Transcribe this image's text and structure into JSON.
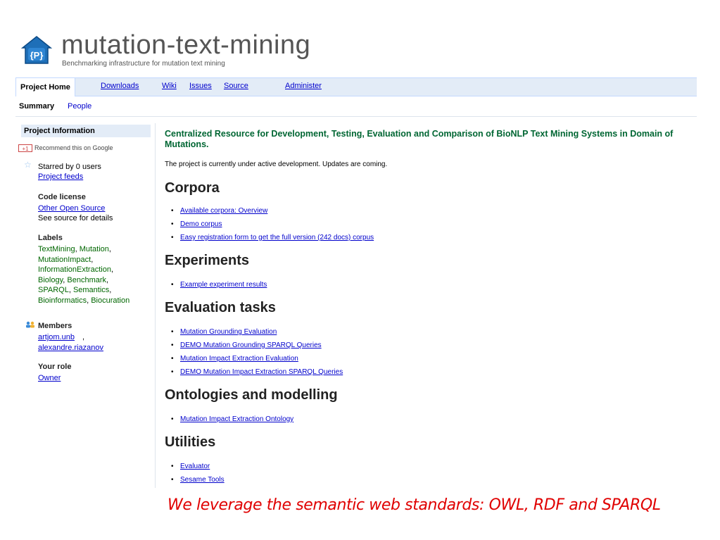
{
  "header": {
    "title": "mutation-text-mining",
    "subtitle": "Benchmarking infrastructure for mutation text mining"
  },
  "tabs": {
    "project_home": "Project Home",
    "downloads": "Downloads",
    "wiki": "Wiki",
    "issues": "Issues",
    "source": "Source",
    "administer": "Administer"
  },
  "subtabs": {
    "summary": "Summary",
    "people": "People"
  },
  "sidebar": {
    "title": "Project Information",
    "google_badge": "+1",
    "recommend": "Recommend this on Google",
    "starred": "Starred by 0 users",
    "project_feeds": "Project feeds",
    "code_license_title": "Code license",
    "code_license_link": "Other Open Source",
    "code_license_note": "See source for details",
    "labels_title": "Labels",
    "labels": [
      "TextMining",
      "Mutation",
      "MutationImpact",
      "InformationExtraction",
      "Biology",
      "Benchmark",
      "SPARQL",
      "Semantics",
      "Bioinformatics",
      "Biocuration"
    ],
    "members_title": "Members",
    "members": [
      "artjom.unb",
      "alexandre.riazanov"
    ],
    "role_title": "Your role",
    "role_value": "Owner"
  },
  "main": {
    "headline": "Centralized Resource for Development, Testing, Evaluation and Comparison of BioNLP Text Mining Systems in Domain of Mutations.",
    "intro": "The project is currently under active development. Updates are coming.",
    "sections": [
      {
        "title": "Corpora",
        "items": [
          "Available corpora: Overview",
          "Demo corpus",
          "Easy registration form to get the full version (242 docs) corpus"
        ]
      },
      {
        "title": "Experiments",
        "items": [
          "Example experiment results"
        ]
      },
      {
        "title": "Evaluation tasks",
        "items": [
          "Mutation Grounding Evaluation",
          "DEMO Mutation Grounding SPARQL Queries",
          "Mutation Impact Extraction Evaluation",
          "DEMO Mutation Impact Extraction SPARQL Queries"
        ]
      },
      {
        "title": "Ontologies and modelling",
        "items": [
          "Mutation Impact Extraction Ontology"
        ]
      },
      {
        "title": "Utilities",
        "items": [
          "Evaluator",
          "Sesame Tools"
        ]
      }
    ]
  },
  "footer_note": "We leverage the semantic web standards: OWL, RDF and SPARQL",
  "colors": {
    "accent_green": "#006633",
    "link_blue": "#0000cc",
    "label_green": "#006600",
    "tab_bar": "#e3ecf7",
    "note_red": "#e00000"
  },
  "icons": {
    "logo": "project-logo-icon",
    "star": "star-icon",
    "members": "members-icon"
  }
}
